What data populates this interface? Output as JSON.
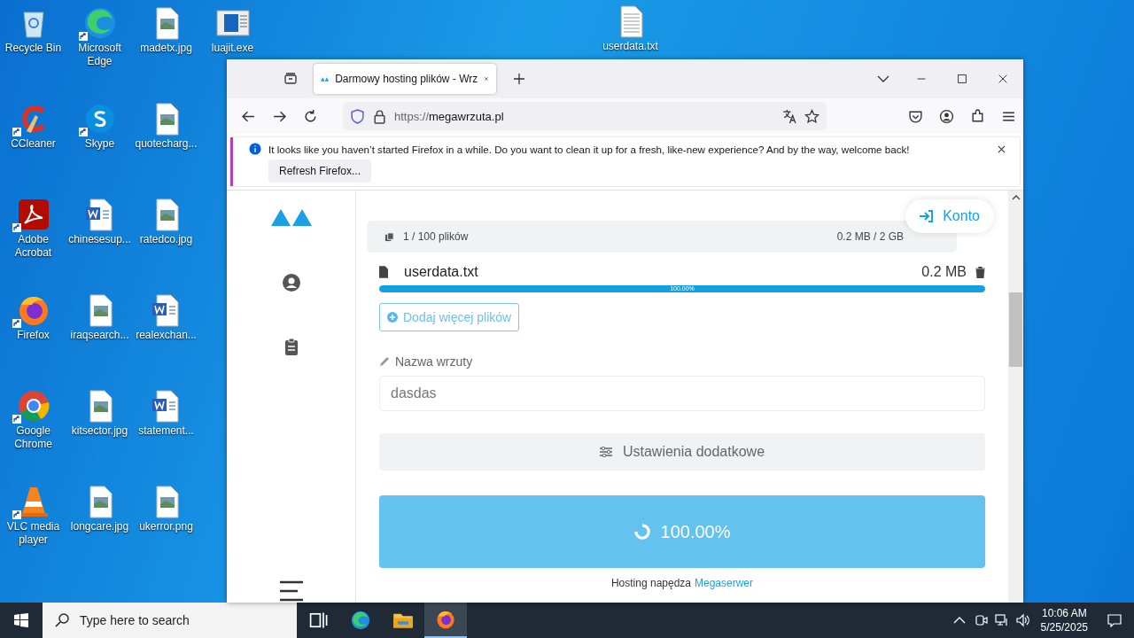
{
  "desktop_icons": [
    {
      "label": "Recycle Bin",
      "kind": "recycle",
      "shortcut": false
    },
    {
      "label": "CCleaner",
      "kind": "ccleaner",
      "shortcut": true
    },
    {
      "label": "Adobe Acrobat",
      "kind": "acrobat",
      "shortcut": true
    },
    {
      "label": "Firefox",
      "kind": "firefox",
      "shortcut": true
    },
    {
      "label": "Google Chrome",
      "kind": "chrome",
      "shortcut": true
    },
    {
      "label": "VLC media player",
      "kind": "vlc",
      "shortcut": true
    },
    {
      "label": "Microsoft Edge",
      "kind": "edge",
      "shortcut": true
    },
    {
      "label": "Skype",
      "kind": "skype",
      "shortcut": true
    },
    {
      "label": "chinesesup...",
      "kind": "word",
      "shortcut": false
    },
    {
      "label": "iraqsearch...",
      "kind": "image",
      "shortcut": false
    },
    {
      "label": "kitsector.jpg",
      "kind": "image",
      "shortcut": false
    },
    {
      "label": "longcare.jpg",
      "kind": "image",
      "shortcut": false
    },
    {
      "label": "madetx.jpg",
      "kind": "image",
      "shortcut": false
    },
    {
      "label": "quotecharg...",
      "kind": "image",
      "shortcut": false
    },
    {
      "label": "ratedco.jpg",
      "kind": "image",
      "shortcut": false
    },
    {
      "label": "realexchan...",
      "kind": "word",
      "shortcut": false
    },
    {
      "label": "statement...",
      "kind": "word",
      "shortcut": false
    },
    {
      "label": "ukerror.png",
      "kind": "image",
      "shortcut": false
    },
    {
      "label": "luajit.exe",
      "kind": "exe",
      "shortcut": false
    }
  ],
  "desktop_file": {
    "label": "userdata.txt",
    "kind": "text"
  },
  "browser": {
    "tabs": [
      {
        "title": "Darmowy hosting plików - Wrz",
        "selected": true
      }
    ],
    "url_scheme": "https://",
    "url_host": "megawrzuta.pl",
    "notification": {
      "message": "It looks like you haven’t started Firefox in a while. Do you want to clean it up for a fresh, like-new experience? And by the way, welcome back!",
      "button": "Refresh Firefox..."
    }
  },
  "page": {
    "account_button": "Konto",
    "summary": {
      "count": "1 / 100 plików",
      "size": "0.2 MB / 2 GB"
    },
    "files": [
      {
        "name": "userdata.txt",
        "size": "0.2 MB",
        "level": 1,
        "progress_label": "100.00%"
      }
    ],
    "add_button": "Dodaj więcej plików",
    "name_label": "Nazwa wrzuty",
    "name_value": "dasdas",
    "settings_button": "Ustawienia dodatkowe",
    "upload_button": "100.00%",
    "footer_text": "Hosting napędza",
    "footer_link": "Megaserwer"
  },
  "taskbar": {
    "search_placeholder": "Type here to search",
    "apps": [
      {
        "kind": "taskview",
        "selected": false
      },
      {
        "kind": "edge",
        "selected": false
      },
      {
        "kind": "explorer",
        "selected": false
      },
      {
        "kind": "firefox",
        "selected": true
      }
    ],
    "time": "10:06 AM",
    "date": "5/25/2025"
  }
}
